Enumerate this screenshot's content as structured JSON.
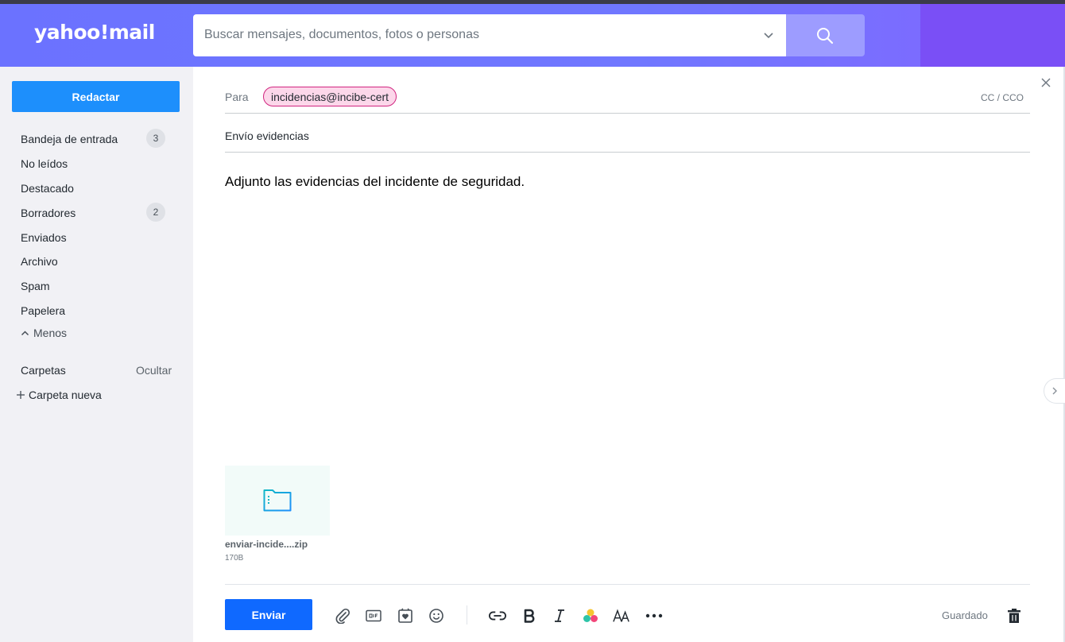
{
  "header": {
    "logo": "yahoo!mail",
    "search_placeholder": "Buscar mensajes, documentos, fotos o personas",
    "icons": [
      "chevron-down-icon",
      "search-icon"
    ],
    "colors": {
      "header": "#6b72ff",
      "search_button": "#9d9cff"
    }
  },
  "sidebar": {
    "compose_label": "Redactar",
    "items": [
      {
        "label": "Bandeja de entrada",
        "count": "3"
      },
      {
        "label": "No leídos"
      },
      {
        "label": "Destacado"
      },
      {
        "label": "Borradores",
        "count": "2"
      },
      {
        "label": "Enviados"
      },
      {
        "label": "Archivo"
      },
      {
        "label": "Spam"
      },
      {
        "label": "Papelera"
      }
    ],
    "less_label": "Menos",
    "folders_label": "Carpetas",
    "hide_label": "Ocultar",
    "new_folder_label": "Carpeta nueva",
    "colors": {
      "compose": "#1d8ffc"
    }
  },
  "compose": {
    "to_label": "Para",
    "recipient": "incidencias@incibe-cert",
    "cc_label": "CC / CCO",
    "subject": "Envío evidencias",
    "body": "Adjunto las evidencias del incidente de seguridad.",
    "attachment": {
      "name": "enviar-incide....zip",
      "size": "170B"
    },
    "send_label": "Enviar",
    "status": "Guardado",
    "toolbar_icons": [
      "paperclip-icon",
      "gif-icon",
      "sticker-icon",
      "emoji-icon",
      "link-icon",
      "bold-icon",
      "italic-icon",
      "color-icon",
      "font-size-icon",
      "more-icon",
      "trash-icon"
    ],
    "colors": {
      "send": "#0f69ff",
      "chip_border": "#d1257f",
      "chip_bg": "#fcd7ea"
    }
  }
}
